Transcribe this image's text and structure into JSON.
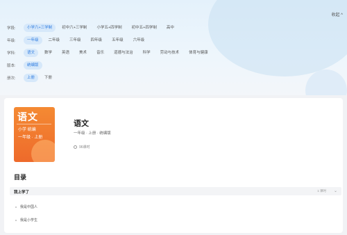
{
  "header": {
    "collapse_label": "收起 ^"
  },
  "filters": {
    "school": {
      "label": "学段:",
      "options": [
        "小学六+三学制",
        "初中六+三学制",
        "小学五+四学制",
        "初中五+四学制",
        "高中"
      ],
      "selected": 0
    },
    "grade": {
      "label": "年级:",
      "options": [
        "一年级",
        "二年级",
        "三年级",
        "四年级",
        "五年级",
        "六年级"
      ],
      "selected": 0
    },
    "subject": {
      "label": "学科:",
      "options": [
        "语文",
        "数学",
        "英语",
        "美术",
        "音乐",
        "道德与法治",
        "科学",
        "劳动与技术",
        "体育与健康"
      ],
      "selected": 0
    },
    "edition": {
      "label": "版本:",
      "options": [
        "统编版"
      ],
      "selected": 0
    },
    "volume": {
      "label": "册次:",
      "options": [
        "上册",
        "下册"
      ],
      "selected": 0
    }
  },
  "course": {
    "cover": {
      "big": "语文",
      "line1": "小学 统编",
      "line2": "一年级 · 上册"
    },
    "title": "语文",
    "meta": "一年级 · 上册 · 统编版",
    "lessons_count": "96课时"
  },
  "toc": {
    "heading": "目录",
    "units": [
      {
        "name": "我上学了",
        "count": "1 课时",
        "lessons": [
          "我是中国人",
          "我是小学生"
        ]
      }
    ]
  }
}
